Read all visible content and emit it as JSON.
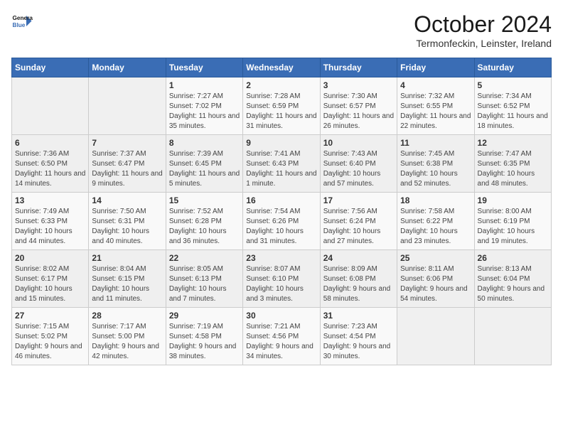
{
  "header": {
    "logo_line1": "General",
    "logo_line2": "Blue",
    "month_title": "October 2024",
    "subtitle": "Termonfeckin, Leinster, Ireland"
  },
  "weekdays": [
    "Sunday",
    "Monday",
    "Tuesday",
    "Wednesday",
    "Thursday",
    "Friday",
    "Saturday"
  ],
  "weeks": [
    [
      {
        "day": "",
        "info": ""
      },
      {
        "day": "",
        "info": ""
      },
      {
        "day": "1",
        "info": "Sunrise: 7:27 AM\nSunset: 7:02 PM\nDaylight: 11 hours and 35 minutes."
      },
      {
        "day": "2",
        "info": "Sunrise: 7:28 AM\nSunset: 6:59 PM\nDaylight: 11 hours and 31 minutes."
      },
      {
        "day": "3",
        "info": "Sunrise: 7:30 AM\nSunset: 6:57 PM\nDaylight: 11 hours and 26 minutes."
      },
      {
        "day": "4",
        "info": "Sunrise: 7:32 AM\nSunset: 6:55 PM\nDaylight: 11 hours and 22 minutes."
      },
      {
        "day": "5",
        "info": "Sunrise: 7:34 AM\nSunset: 6:52 PM\nDaylight: 11 hours and 18 minutes."
      }
    ],
    [
      {
        "day": "6",
        "info": "Sunrise: 7:36 AM\nSunset: 6:50 PM\nDaylight: 11 hours and 14 minutes."
      },
      {
        "day": "7",
        "info": "Sunrise: 7:37 AM\nSunset: 6:47 PM\nDaylight: 11 hours and 9 minutes."
      },
      {
        "day": "8",
        "info": "Sunrise: 7:39 AM\nSunset: 6:45 PM\nDaylight: 11 hours and 5 minutes."
      },
      {
        "day": "9",
        "info": "Sunrise: 7:41 AM\nSunset: 6:43 PM\nDaylight: 11 hours and 1 minute."
      },
      {
        "day": "10",
        "info": "Sunrise: 7:43 AM\nSunset: 6:40 PM\nDaylight: 10 hours and 57 minutes."
      },
      {
        "day": "11",
        "info": "Sunrise: 7:45 AM\nSunset: 6:38 PM\nDaylight: 10 hours and 52 minutes."
      },
      {
        "day": "12",
        "info": "Sunrise: 7:47 AM\nSunset: 6:35 PM\nDaylight: 10 hours and 48 minutes."
      }
    ],
    [
      {
        "day": "13",
        "info": "Sunrise: 7:49 AM\nSunset: 6:33 PM\nDaylight: 10 hours and 44 minutes."
      },
      {
        "day": "14",
        "info": "Sunrise: 7:50 AM\nSunset: 6:31 PM\nDaylight: 10 hours and 40 minutes."
      },
      {
        "day": "15",
        "info": "Sunrise: 7:52 AM\nSunset: 6:28 PM\nDaylight: 10 hours and 36 minutes."
      },
      {
        "day": "16",
        "info": "Sunrise: 7:54 AM\nSunset: 6:26 PM\nDaylight: 10 hours and 31 minutes."
      },
      {
        "day": "17",
        "info": "Sunrise: 7:56 AM\nSunset: 6:24 PM\nDaylight: 10 hours and 27 minutes."
      },
      {
        "day": "18",
        "info": "Sunrise: 7:58 AM\nSunset: 6:22 PM\nDaylight: 10 hours and 23 minutes."
      },
      {
        "day": "19",
        "info": "Sunrise: 8:00 AM\nSunset: 6:19 PM\nDaylight: 10 hours and 19 minutes."
      }
    ],
    [
      {
        "day": "20",
        "info": "Sunrise: 8:02 AM\nSunset: 6:17 PM\nDaylight: 10 hours and 15 minutes."
      },
      {
        "day": "21",
        "info": "Sunrise: 8:04 AM\nSunset: 6:15 PM\nDaylight: 10 hours and 11 minutes."
      },
      {
        "day": "22",
        "info": "Sunrise: 8:05 AM\nSunset: 6:13 PM\nDaylight: 10 hours and 7 minutes."
      },
      {
        "day": "23",
        "info": "Sunrise: 8:07 AM\nSunset: 6:10 PM\nDaylight: 10 hours and 3 minutes."
      },
      {
        "day": "24",
        "info": "Sunrise: 8:09 AM\nSunset: 6:08 PM\nDaylight: 9 hours and 58 minutes."
      },
      {
        "day": "25",
        "info": "Sunrise: 8:11 AM\nSunset: 6:06 PM\nDaylight: 9 hours and 54 minutes."
      },
      {
        "day": "26",
        "info": "Sunrise: 8:13 AM\nSunset: 6:04 PM\nDaylight: 9 hours and 50 minutes."
      }
    ],
    [
      {
        "day": "27",
        "info": "Sunrise: 7:15 AM\nSunset: 5:02 PM\nDaylight: 9 hours and 46 minutes."
      },
      {
        "day": "28",
        "info": "Sunrise: 7:17 AM\nSunset: 5:00 PM\nDaylight: 9 hours and 42 minutes."
      },
      {
        "day": "29",
        "info": "Sunrise: 7:19 AM\nSunset: 4:58 PM\nDaylight: 9 hours and 38 minutes."
      },
      {
        "day": "30",
        "info": "Sunrise: 7:21 AM\nSunset: 4:56 PM\nDaylight: 9 hours and 34 minutes."
      },
      {
        "day": "31",
        "info": "Sunrise: 7:23 AM\nSunset: 4:54 PM\nDaylight: 9 hours and 30 minutes."
      },
      {
        "day": "",
        "info": ""
      },
      {
        "day": "",
        "info": ""
      }
    ]
  ]
}
